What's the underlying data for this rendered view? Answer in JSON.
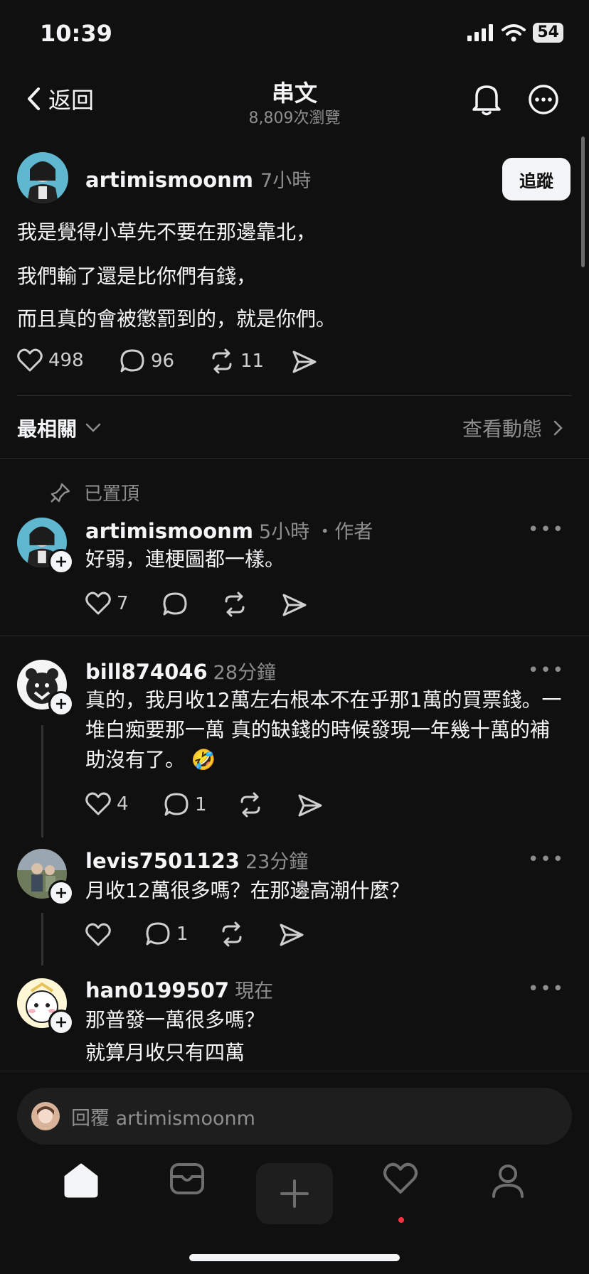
{
  "status": {
    "time": "10:39",
    "battery": "54"
  },
  "header": {
    "back_label": "返回",
    "title": "串文",
    "views": "8,809次瀏覽"
  },
  "post": {
    "username": "artimismoonm",
    "time": "7小時",
    "follow_label": "追蹤",
    "lines": [
      "我是覺得小草先不要在那邊靠北，",
      "我們輸了還是比你們有錢，",
      "而且真的會被懲罰到的，就是你們。"
    ],
    "likes": "498",
    "replies": "96",
    "reposts": "11"
  },
  "sort": {
    "label": "最相關",
    "activity_label": "查看動態"
  },
  "comments": [
    {
      "pinned_label": "已置頂",
      "username": "artimismoonm",
      "time": "5小時",
      "role": "・作者",
      "text": "好弱，連梗圖都一樣。",
      "likes": "7",
      "replies": "",
      "more": "•••"
    },
    {
      "username": "bill874046",
      "time": "28分鐘",
      "text": "真的，我月收12萬左右根本不在乎那1萬的買票錢。一堆白痴要那一萬 真的缺錢的時候發現一年幾十萬的補助沒有了。 🤣",
      "likes": "4",
      "replies": "1",
      "more": "•••"
    },
    {
      "username": "levis7501123",
      "time": "23分鐘",
      "text": "月收12萬很多嗎？在那邊高潮什麼？",
      "likes": "",
      "replies": "1",
      "more": "•••"
    },
    {
      "username": "han0199507",
      "time": "現在",
      "text_lines": [
        "那普發一萬很多嗎？",
        "就算月收只有四萬"
      ],
      "more": "•••"
    }
  ],
  "reply_bar": {
    "placeholder": "回覆 artimismoonm"
  },
  "colors": {
    "background": "#101010",
    "text": "#f3f5f7",
    "muted": "#8e8e8e",
    "notification_dot": "#ff3040"
  },
  "nav": [
    "home-icon",
    "inbox-icon",
    "create-icon",
    "activity-icon",
    "profile-icon"
  ]
}
